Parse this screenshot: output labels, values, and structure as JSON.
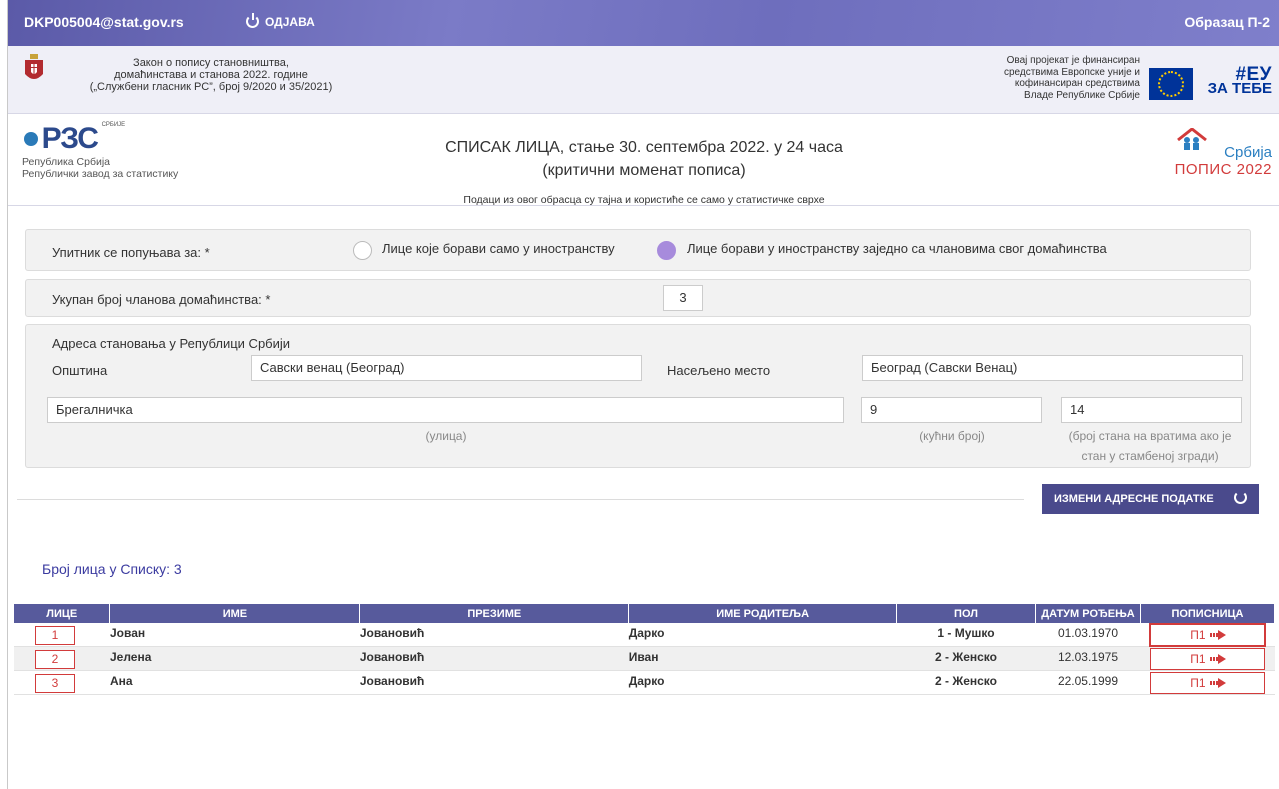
{
  "topbar": {
    "user": "DKP005004@stat.gov.rs",
    "logout_label": "ОДЈАВА",
    "form_label": "Образац П-2"
  },
  "header": {
    "law_lines": [
      "Закон о попису становништва,",
      "домаћинстава и станова 2022. године",
      "(„Службени гласник РС”, број 9/2020 и 35/2021)"
    ],
    "eu_text_lines": [
      "Овај пројекат је финансиран",
      "средствима Европске уније и",
      "кофинансиран средствима",
      "Владе Републике Србије"
    ],
    "eu_logo_big": "#ЕУ",
    "eu_logo_small": "ЗА ТЕБЕ",
    "rzs_logo_text": "РЗС",
    "rzs_logo_sub": "СРБИЈЕ",
    "rzs_name1": "Република Србија",
    "rzs_name2": "Републички завод за статистику",
    "title_line1": "СПИСАК ЛИЦА, стање 30. септембра 2022. у 24 часа",
    "title_line2": "(критични моменат пописа)",
    "secrecy_note": "Подаци из овог обрасца су тајна и користиће се само у статистичке сврхе",
    "popis_srbija": "Србија",
    "popis_label": "ПОПИС 2022"
  },
  "form": {
    "fill_for_label": "Упитник се попуњава за: *",
    "option1": "Лице које борави само у иностранству",
    "option2": "Лице борави у иностранству заједно са члановима свог домаћинства",
    "selected_option": 2,
    "members_label": "Укупан број чланова домаћинства: *",
    "members_value": "3",
    "address_title": "Адреса становања у Републици Србији",
    "municipality_label": "Општина",
    "municipality_value": "Савски венац (Београд)",
    "settlement_label": "Насељено место",
    "settlement_value": "Београд (Савски Венац)",
    "street_value": "Брегалничка",
    "house_number_value": "9",
    "apartment_value": "14",
    "street_hint": "(улица)",
    "house_hint": "(кућни број)",
    "apartment_hint_1": "(број стана на вратима ако је",
    "apartment_hint_2": "стан у стамбеној згради)",
    "change_address_button": "ИЗМЕНИ АДРЕСНЕ ПОДАТКЕ"
  },
  "list": {
    "count_label": "Број лица у Списку: 3",
    "columns": [
      "ЛИЦЕ",
      "ИМЕ",
      "ПРЕЗИМЕ",
      "ИМЕ РОДИТЕЉА",
      "ПОЛ",
      "ДАТУМ РОЂЕЊА",
      "ПОПИСНИЦА"
    ],
    "rows": [
      {
        "num": "1",
        "first": "Јован",
        "last": "Јовановић",
        "parent": "Дарко",
        "sex": "1 - Мушко",
        "dob": "01.03.1970",
        "form": "П1"
      },
      {
        "num": "2",
        "first": "Јелена",
        "last": "Јовановић",
        "parent": "Иван",
        "sex": "2 - Женско",
        "dob": "12.03.1975",
        "form": "П1"
      },
      {
        "num": "3",
        "first": "Ана",
        "last": "Јовановић",
        "parent": "Дарко",
        "sex": "2 - Женско",
        "dob": "22.05.1999",
        "form": "П1"
      }
    ]
  }
}
